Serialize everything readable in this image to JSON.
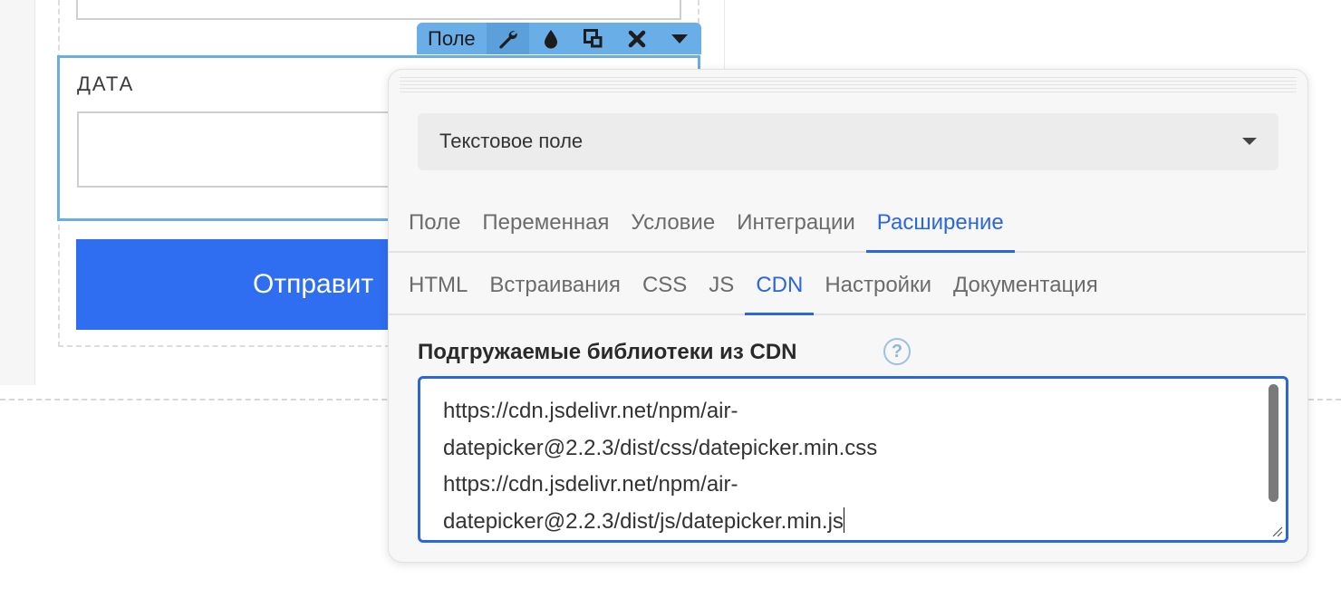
{
  "form": {
    "date_label": "ДАТА",
    "submit_label": "Отправит"
  },
  "field_toolbar": {
    "label": "Поле",
    "tools": [
      "wrench-icon",
      "drop-icon",
      "copy-icon",
      "close-icon",
      "caret-down-icon"
    ]
  },
  "panel": {
    "field_type": "Текстовое поле",
    "main_tabs": [
      {
        "label": "Поле",
        "active": false
      },
      {
        "label": "Переменная",
        "active": false
      },
      {
        "label": "Условие",
        "active": false
      },
      {
        "label": "Интеграции",
        "active": false
      },
      {
        "label": "Расширение",
        "active": true
      }
    ],
    "sub_tabs": [
      {
        "label": "HTML",
        "active": false
      },
      {
        "label": "Встраивания",
        "active": false
      },
      {
        "label": "CSS",
        "active": false
      },
      {
        "label": "JS",
        "active": false
      },
      {
        "label": "CDN",
        "active": true
      },
      {
        "label": "Настройки",
        "active": false
      },
      {
        "label": "Документация",
        "active": false
      }
    ],
    "cdn": {
      "title": "Подгружаемые библиотеки из CDN",
      "help": "?",
      "lines": [
        "https://cdn.jsdelivr.net/npm/air-",
        "datepicker@2.2.3/dist/css/datepicker.min.css",
        "https://cdn.jsdelivr.net/npm/air-",
        "datepicker@2.2.3/dist/js/datepicker.min.js"
      ]
    }
  },
  "colors": {
    "accent": "#2a66e0",
    "submit_button": "#2f6ef0",
    "field_highlight": "#6aaee8"
  }
}
